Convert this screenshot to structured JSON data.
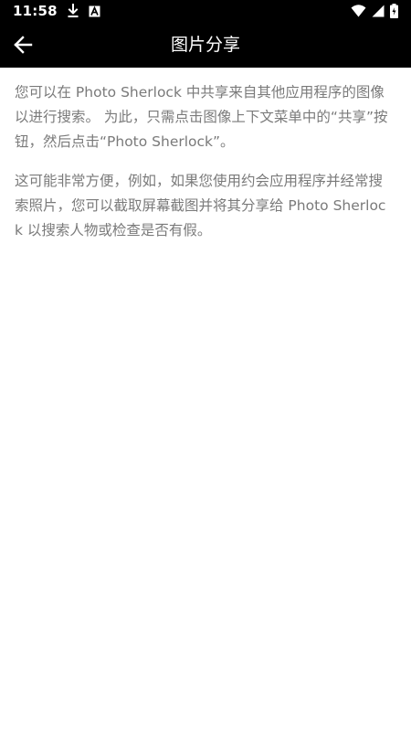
{
  "status_bar": {
    "time": "11:58",
    "icons": [
      "download-icon",
      "notification-a-icon",
      "wifi-icon",
      "signal-icon",
      "battery-icon"
    ]
  },
  "app_bar": {
    "title": "图片分享",
    "back_icon": "arrow-left-icon"
  },
  "content": {
    "paragraph_1": "您可以在 Photo Sherlock 中共享来自其他应用程序的图像以进行搜索。 为此，只需点击图像上下文菜单中的“共享”按钮，然后点击“Photo Sherlock”。",
    "paragraph_2": "这可能非常方便，例如，如果您使用约会应用程序并经常搜索照片，您可以截取屏幕截图并将其分享给 Photo Sherlock 以搜索人物或检查是否有假。"
  },
  "colors": {
    "bar_background": "#000000",
    "bar_foreground": "#ffffff",
    "body_text": "#7a7a7a",
    "page_background": "#ffffff"
  }
}
